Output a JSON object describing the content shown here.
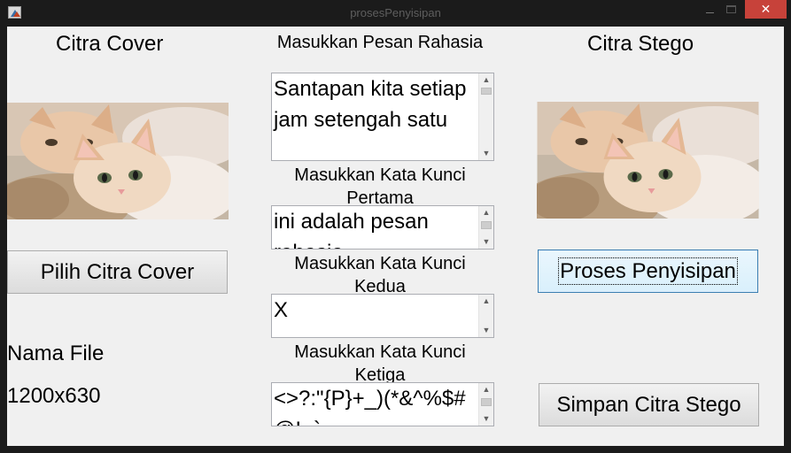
{
  "window": {
    "title": "prosesPenyisipan",
    "close_glyph": "✕"
  },
  "cover": {
    "heading": "Citra Cover",
    "select_button": "Pilih Citra Cover",
    "file_name_label": "Nama File",
    "dimensions": "1200x630"
  },
  "stego": {
    "heading": "Citra Stego",
    "process_button": "Proses Penyisipan",
    "save_button": "Simpan Citra Stego"
  },
  "inputs": {
    "message_label": "Masukkan Pesan Rahasia",
    "message_value": "Santapan kita setiap jam setengah satu",
    "key1_label": "Masukkan Kata Kunci Pertama",
    "key1_value": "ini adalah pesan rahasia",
    "key2_label": "Masukkan Kata Kunci Kedua",
    "key2_value": "X",
    "key3_label": "Masukkan Kata Kunci Ketiga",
    "key3_value": "<>?:\"{P}+_)(*&^%$#@!~`"
  },
  "colors": {
    "close": "#c7423a",
    "focus_border": "#3c7fb1"
  },
  "icons": {
    "app": "matlab-figure-icon",
    "scroll_up": "chevron-up-icon",
    "scroll_down": "chevron-down-icon"
  }
}
